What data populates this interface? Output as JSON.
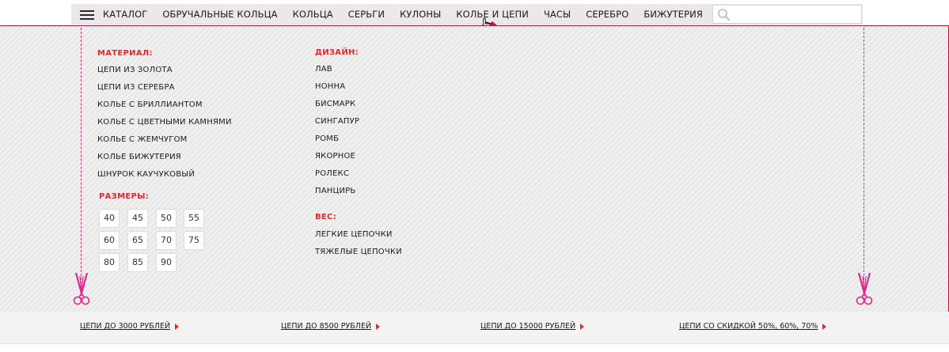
{
  "nav": {
    "catalog_label": "КАТАЛОГ",
    "items": [
      {
        "label": "ОБРУЧАЛЬНЫЕ КОЛЬЦА"
      },
      {
        "label": "КОЛЬЦА"
      },
      {
        "label": "СЕРЬГИ"
      },
      {
        "label": "КУЛОНЫ"
      },
      {
        "label": "КОЛЬЕ И ЦЕПИ",
        "active": true
      },
      {
        "label": "ЧАСЫ"
      },
      {
        "label": "СЕРЕБРО"
      },
      {
        "label": "БИЖУТЕРИЯ"
      }
    ],
    "search_value": ""
  },
  "menu": {
    "material": {
      "title": "МАТЕРИАЛ:",
      "items": [
        "ЦЕПИ ИЗ ЗОЛОТА",
        "ЦЕПИ ИЗ СЕРЕБРА",
        "КОЛЬЕ С БРИЛЛИАНТОМ",
        "КОЛЬЕ С ЦВЕТНЫМИ КАМНЯМИ",
        "КОЛЬЕ С ЖЕМЧУГОМ",
        "КОЛЬЕ БИЖУТЕРИЯ",
        "ШНУРОК КАУЧУКОВЫЙ"
      ]
    },
    "sizes": {
      "title": "РАЗМЕРЫ:",
      "values": [
        "40",
        "45",
        "50",
        "55",
        "60",
        "65",
        "70",
        "75",
        "80",
        "85",
        "90"
      ]
    },
    "design": {
      "title": "ДИЗАЙН:",
      "items": [
        "ЛАВ",
        "НОННА",
        "БИСМАРК",
        "СИНГАПУР",
        "РОМБ",
        "ЯКОРНОЕ",
        "РОЛЕКС",
        "ПАНЦИРЬ"
      ]
    },
    "weight": {
      "title": "ВЕС:",
      "items": [
        "ЛЕГКИЕ ЦЕПОЧКИ",
        "ТЯЖЕЛЫЕ ЦЕПОЧКИ"
      ]
    }
  },
  "promo": [
    "ЦЕПИ ДО 3000 РУБЛЕЙ",
    "ЦЕПИ  ДО 8500 РУБЛЕЙ",
    "ЦЕПИ  ДО 15000 РУБЛЕЙ",
    "ЦЕПИ  СО СКИДКОЙ 50%, 60%, 70%"
  ],
  "colors": {
    "accent": "#e8272b",
    "scissors": "#e0288a",
    "nav_background": "#ece7ea"
  }
}
